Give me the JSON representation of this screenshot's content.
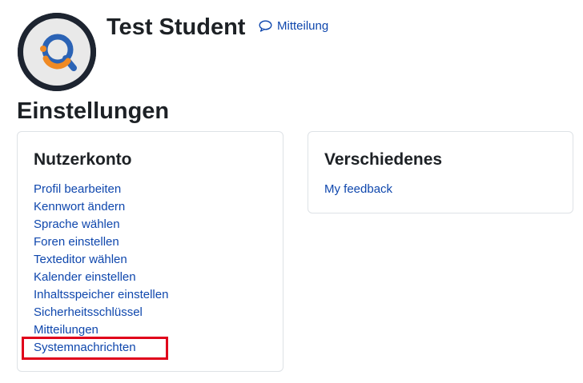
{
  "profile": {
    "name": "Test Student",
    "message_label": "Mitteilung"
  },
  "page": {
    "title": "Einstellungen"
  },
  "account_card": {
    "title": "Nutzerkonto",
    "links": [
      "Profil bearbeiten",
      "Kennwort ändern",
      "Sprache wählen",
      "Foren einstellen",
      "Texteditor wählen",
      "Kalender einstellen",
      "Inhaltsspeicher einstellen",
      "Sicherheitsschlüssel",
      "Mitteilungen",
      "Systemnachrichten"
    ],
    "highlighted_link": "Systemnachrichten"
  },
  "misc_card": {
    "title": "Verschiedenes",
    "links": [
      "My feedback"
    ]
  },
  "colors": {
    "link": "#0f47ad",
    "highlight": "#e0001b",
    "logo_blue": "#2b63b5",
    "logo_orange": "#f08a24",
    "avatar_ring": "#1d2430"
  },
  "icons": {
    "message": "speech-bubble-icon",
    "avatar": "search-q-logo"
  }
}
